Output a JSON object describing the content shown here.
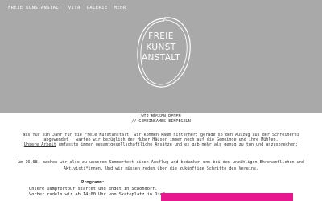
{
  "nav": {
    "items": [
      "FREIE KUNSTANSTALT",
      "VITA",
      "GALERIE",
      "MEHR"
    ]
  },
  "logo": {
    "lines": [
      "FREIE",
      "KUNST",
      "ANSTALT"
    ]
  },
  "intro": {
    "line1": "WIR MÜSSEN REDEN",
    "line2": "// GEMEINSAMES EINPEGELN"
  },
  "para1": {
    "l1_a": "Was für ein Jahr für die ",
    "l1_link": "Freie Kunstanstalt",
    "l1_b": "! wir kommen kaum hinterher: gerade so den Auszug aus der Schreinerei",
    "l2_a": "abgewendet , warten wir bezüglich der ",
    "l2_link": "Huber Häuser",
    "l2_b": " immer noch auf die Gemeinde und ihre Mühlen.",
    "l3_link": "Unsere Arbeit",
    "l3_b": " umfasste immer gesamtgesellschaftliche Ansätze und es gab mehr als genug zu tun und anzusprechen:"
  },
  "para2": {
    "l1": "Am 16.08. machen wir also zu unserem Sommerfest einen Ausflug und bedanken uns bei den unzähligen Ehrenamtlichen und",
    "l2": "Aktivisti*innen. Und wir müssen reden über die zukünftige Schritte des Vereins."
  },
  "program": {
    "title": "Programm:",
    "l1": "Unsere Dampfertour startet und endet in Schondorf.",
    "l2": "Vorher radeln wir ab 14:00 Uhr vom Skateplatz in Dießen"
  },
  "colors": {
    "hero_bg": "#a9a9a9",
    "accent_pink": "#e8178f"
  }
}
